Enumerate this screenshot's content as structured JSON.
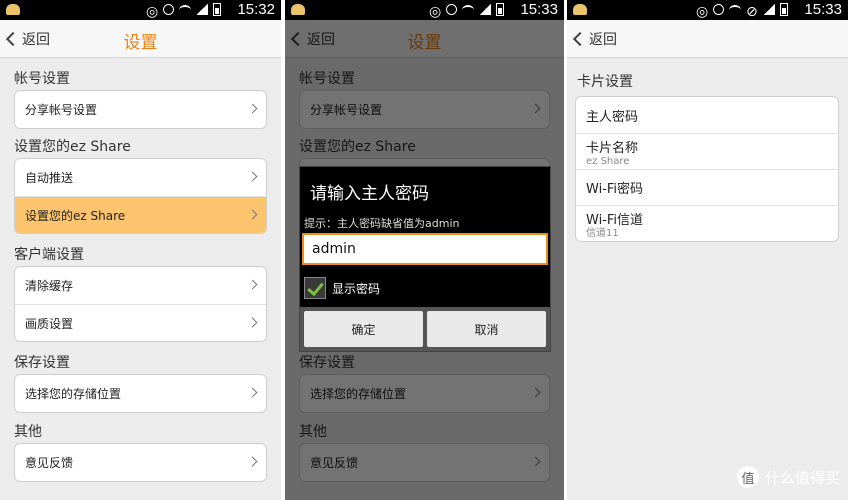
{
  "status_times": [
    "15:32",
    "15:33",
    "15:33"
  ],
  "screen1": {
    "back_label": "返回",
    "title": "设置",
    "sections": [
      {
        "title": "帐号设置",
        "items": [
          "分享帐号设置"
        ]
      },
      {
        "title": "设置您的ez Share",
        "items": [
          "自动推送",
          "设置您的ez Share"
        ]
      },
      {
        "title": "客户端设置",
        "items": [
          "清除缓存",
          "画质设置"
        ]
      },
      {
        "title": "保存设置",
        "items": [
          "选择您的存储位置"
        ]
      },
      {
        "title": "其他",
        "items": [
          "意见反馈"
        ]
      }
    ]
  },
  "screen2": {
    "back_label": "返回",
    "title": "设置",
    "dialog": {
      "title": "请输入主人密码",
      "hint": "提示：主人密码缺省值为admin",
      "input_value": "admin",
      "show_password_label": "显示密码",
      "show_password_checked": true,
      "ok_label": "确定",
      "cancel_label": "取消"
    }
  },
  "screen3": {
    "back_label": "返回",
    "section_title": "卡片设置",
    "items": [
      {
        "label": "主人密码",
        "sub": ""
      },
      {
        "label": "卡片名称",
        "sub": "ez Share"
      },
      {
        "label": "Wi-Fi密码",
        "sub": ""
      },
      {
        "label": "Wi-Fi信道",
        "sub": "信道11"
      }
    ]
  },
  "watermark": {
    "badge": "值",
    "text": "什么值得买"
  },
  "colors": {
    "accent": "#e8821a",
    "selected": "#fcc46c",
    "check": "#7cc242"
  }
}
